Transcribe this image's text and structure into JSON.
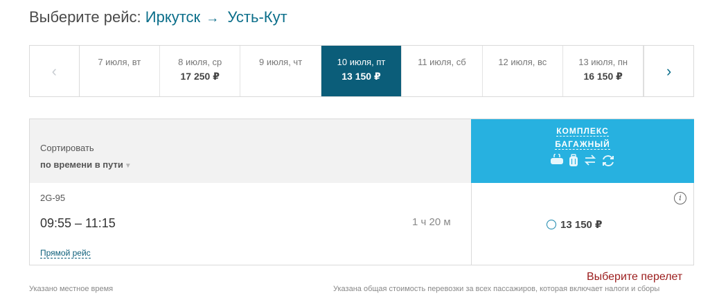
{
  "header": {
    "prefix": "Выберите рейс:",
    "from": "Иркутск",
    "arrow": "→",
    "to": "Усть-Кут"
  },
  "dates": {
    "prev_icon": "chevron-left-icon",
    "next_icon": "chevron-right-icon",
    "days": [
      {
        "date": "7 июля, вт",
        "price": ""
      },
      {
        "date": "8 июля, ср",
        "price": "17 250 ₽"
      },
      {
        "date": "9 июля, чт",
        "price": ""
      },
      {
        "date": "10 июля, пт",
        "price": "13 150 ₽",
        "selected": true
      },
      {
        "date": "11 июля, сб",
        "price": ""
      },
      {
        "date": "12 июля, вс",
        "price": ""
      },
      {
        "date": "13 июля, пн",
        "price": "16 150 ₽"
      }
    ]
  },
  "table": {
    "sort_label": "Сортировать",
    "sort_value": "по времени в пути",
    "tariff_line1": "КОМПЛЕКС",
    "tariff_line2": "БАГАЖНЫЙ",
    "tariff_icons": [
      "bag-icon",
      "suitcase-icon",
      "exchange-icon",
      "refund-icon"
    ],
    "header_color": "#27b1e0"
  },
  "flight": {
    "number": "2G-95",
    "times": "09:55 – 11:15",
    "duration": "1 ч 20 м",
    "direct_label": "Прямой рейс",
    "price": "13 150 ₽"
  },
  "footer": {
    "select_hint": "Выберите перелет",
    "note_left": "Указано местное время",
    "note_right": "Указана общая стоимость перевозки за всех пассажиров, которая включает налоги и сборы"
  },
  "colors": {
    "accent": "#0b5d79",
    "hint": "#9b1c1c"
  }
}
